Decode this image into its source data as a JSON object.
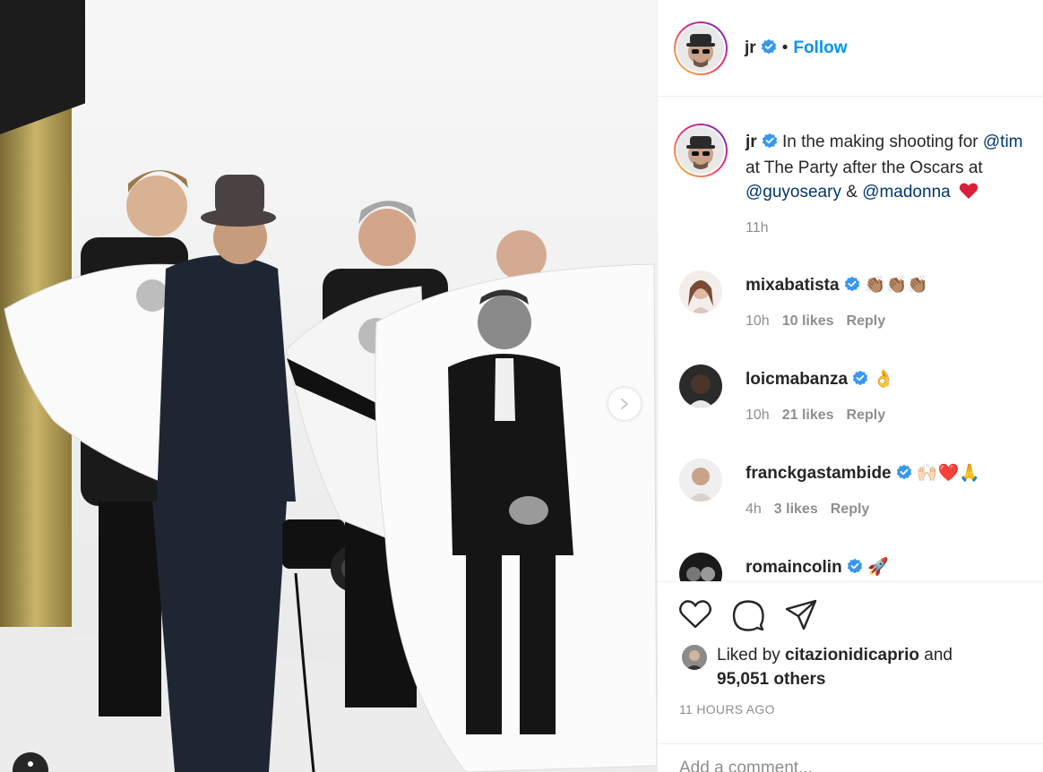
{
  "post": {
    "author": "jr",
    "follow_label": "Follow",
    "dot": "•"
  },
  "caption": {
    "author": "jr",
    "line1_text": "In the making shooting for ",
    "line1_mention": "@tim",
    "line2_text": "at The Party after the Oscars at",
    "line3_mention1": "@guyoseary",
    "line3_amp": " & ",
    "line3_mention2": "@madonna",
    "time": "11h"
  },
  "comments": [
    {
      "user": "mixabatista",
      "emoji": "👏🏽👏🏽👏🏽",
      "time": "10h",
      "likes": "10 likes",
      "reply": "Reply"
    },
    {
      "user": "loicmabanza",
      "emoji": "👌",
      "time": "10h",
      "likes": "21 likes",
      "reply": "Reply"
    },
    {
      "user": "franckgastambide",
      "emoji": "🙌🏻❤️🙏",
      "time": "4h",
      "likes": "3 likes",
      "reply": "Reply"
    },
    {
      "user": "romaincolin",
      "emoji": "🚀",
      "time": "",
      "likes": "",
      "reply": ""
    }
  ],
  "engagement": {
    "liked_prefix": "Liked by ",
    "liked_user": "citazionidicaprio",
    "liked_and": " and",
    "others": "95,051 others",
    "time_ago": "11 HOURS AGO"
  },
  "add_comment": {
    "placeholder": "Add a comment..."
  },
  "colors": {
    "accent": "#0095f6",
    "mention": "#00376b",
    "secondary": "#8e8e8e",
    "verified": "#3897f0",
    "heart": "#ed4956"
  },
  "icons": [
    "verified-icon",
    "heart-icon",
    "comment-icon",
    "share-icon",
    "chevron-right-icon",
    "user-tag-icon"
  ]
}
